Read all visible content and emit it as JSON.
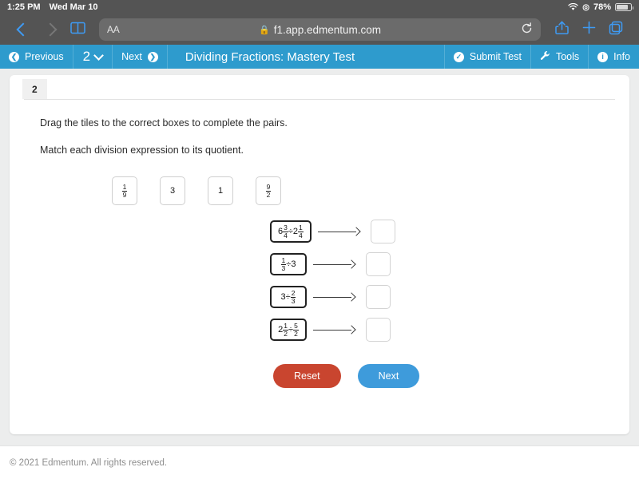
{
  "status_bar": {
    "time": "1:25 PM",
    "date": "Wed Mar 10",
    "wifi_icon": "wifi-icon",
    "location_icon": "location-icon",
    "battery_percent": "78%"
  },
  "browser": {
    "back_icon": "chevron-left-icon",
    "forward_icon": "chevron-right-icon",
    "bookmarks_icon": "book-icon",
    "text_size_label": "AA",
    "lock_icon": "lock-icon",
    "url": "f1.app.edmentum.com",
    "reload_icon": "reload-icon",
    "share_icon": "share-icon",
    "new_tab_icon": "plus-icon",
    "tabs_icon": "tabs-icon"
  },
  "app_bar": {
    "accent_color": "#2e9bcd",
    "previous_label": "Previous",
    "previous_icon": "arrow-left-circle-icon",
    "page_number": "2",
    "page_chevron_icon": "chevron-down-icon",
    "next_label": "Next",
    "next_icon": "arrow-right-circle-icon",
    "title": "Dividing Fractions: Mastery Test",
    "submit_label": "Submit Test",
    "submit_icon": "check-circle-icon",
    "tools_label": "Tools",
    "tools_icon": "wrench-icon",
    "info_label": "Info",
    "info_icon": "info-circle-icon"
  },
  "question": {
    "number": "2",
    "instruction": "Drag the tiles to the correct boxes to complete the pairs.",
    "task": "Match each division expression to its quotient.",
    "tiles": [
      {
        "type": "fraction",
        "numerator": "1",
        "denominator": "9",
        "label": "1/9"
      },
      {
        "type": "whole",
        "value": "3",
        "label": "3"
      },
      {
        "type": "whole",
        "value": "1",
        "label": "1"
      },
      {
        "type": "fraction",
        "numerator": "9",
        "denominator": "2",
        "label": "9/2"
      }
    ],
    "pairs": [
      {
        "expression": "6 3/4 ÷ 2 1/4",
        "left": {
          "whole": "6",
          "numerator": "3",
          "denominator": "4"
        },
        "operator": "÷",
        "right": {
          "whole": "2",
          "numerator": "1",
          "denominator": "4"
        },
        "drop_value": ""
      },
      {
        "expression": "1/3 ÷ 3",
        "left": {
          "whole": "",
          "numerator": "1",
          "denominator": "3"
        },
        "operator": "÷",
        "right": {
          "whole": "3",
          "numerator": "",
          "denominator": ""
        },
        "drop_value": ""
      },
      {
        "expression": "3 ÷ 2/3",
        "left": {
          "whole": "3",
          "numerator": "",
          "denominator": ""
        },
        "operator": "÷",
        "right": {
          "whole": "",
          "numerator": "2",
          "denominator": "3"
        },
        "drop_value": ""
      },
      {
        "expression": "2 1/2 ÷ 5/2",
        "left": {
          "whole": "2",
          "numerator": "1",
          "denominator": "2"
        },
        "operator": "÷",
        "right": {
          "whole": "",
          "numerator": "5",
          "denominator": "2"
        },
        "drop_value": ""
      }
    ],
    "reset_label": "Reset",
    "reset_color": "#c9452f",
    "next_label": "Next",
    "next_color": "#3e9bdb"
  },
  "footer": {
    "copyright": "© 2021 Edmentum. All rights reserved."
  }
}
